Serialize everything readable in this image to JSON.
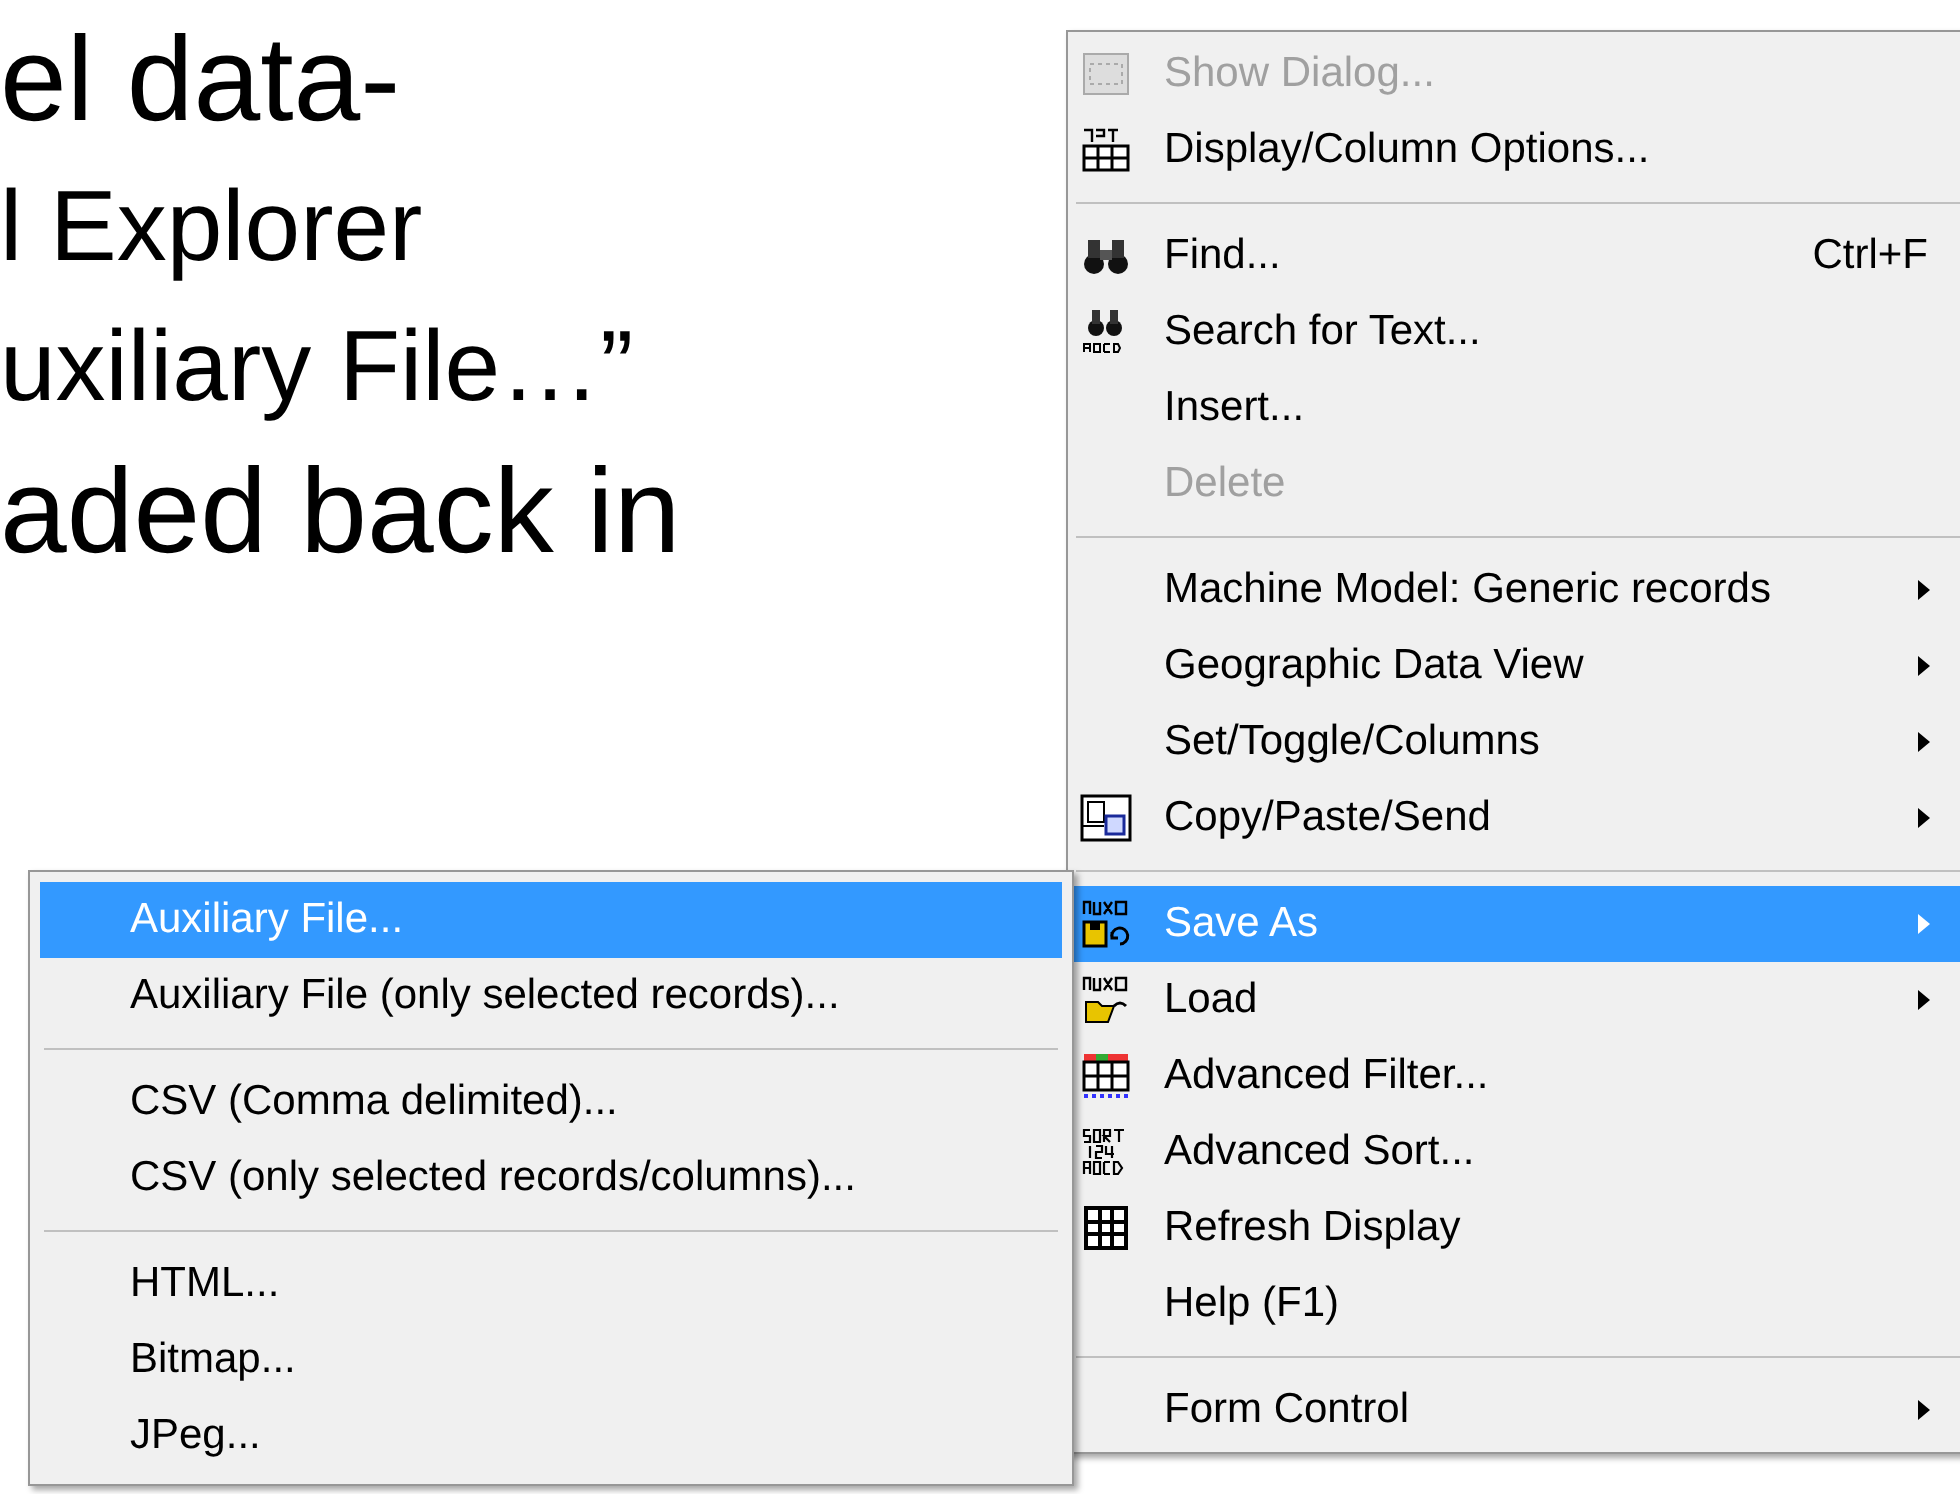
{
  "slide_text": [
    "el data-",
    "l Explorer",
    "uxiliary File…”",
    "aded back in"
  ],
  "context_menu": {
    "items": [
      {
        "kind": "item",
        "label": "Show Dialog...",
        "disabled": true,
        "selected": false,
        "submenu": false
      },
      {
        "kind": "item",
        "label": "Display/Column Options...",
        "disabled": false,
        "selected": false,
        "submenu": false
      },
      {
        "kind": "separator"
      },
      {
        "kind": "item",
        "label": "Find...",
        "shortcut": "Ctrl+F",
        "disabled": false,
        "selected": false,
        "submenu": false
      },
      {
        "kind": "item",
        "label": "Search for Text...",
        "disabled": false,
        "selected": false,
        "submenu": false
      },
      {
        "kind": "item",
        "label": "Insert...",
        "disabled": false,
        "selected": false,
        "submenu": false
      },
      {
        "kind": "item",
        "label": "Delete",
        "disabled": true,
        "selected": false,
        "submenu": false
      },
      {
        "kind": "separator"
      },
      {
        "kind": "item",
        "label": "Machine Model: Generic records",
        "disabled": false,
        "selected": false,
        "submenu": true
      },
      {
        "kind": "item",
        "label": "Geographic Data View",
        "disabled": false,
        "selected": false,
        "submenu": true
      },
      {
        "kind": "item",
        "label": "Set/Toggle/Columns",
        "disabled": false,
        "selected": false,
        "submenu": true
      },
      {
        "kind": "item",
        "label": "Copy/Paste/Send",
        "disabled": false,
        "selected": false,
        "submenu": true
      },
      {
        "kind": "separator"
      },
      {
        "kind": "item",
        "label": "Save As",
        "disabled": false,
        "selected": true,
        "submenu": true
      },
      {
        "kind": "item",
        "label": "Load",
        "disabled": false,
        "selected": false,
        "submenu": true
      },
      {
        "kind": "item",
        "label": "Advanced Filter...",
        "disabled": false,
        "selected": false,
        "submenu": false
      },
      {
        "kind": "item",
        "label": "Advanced Sort...",
        "disabled": false,
        "selected": false,
        "submenu": false
      },
      {
        "kind": "item",
        "label": "Refresh Display",
        "disabled": false,
        "selected": false,
        "submenu": false
      },
      {
        "kind": "item",
        "label": "Help (F1)",
        "disabled": false,
        "selected": false,
        "submenu": false
      },
      {
        "kind": "separator"
      },
      {
        "kind": "item",
        "label": "Form Control",
        "disabled": false,
        "selected": false,
        "submenu": true
      }
    ]
  },
  "save_as_submenu": {
    "items": [
      {
        "kind": "item",
        "label": "Auxiliary File...",
        "selected": true
      },
      {
        "kind": "item",
        "label": "Auxiliary File (only selected records)...",
        "selected": false
      },
      {
        "kind": "separator"
      },
      {
        "kind": "item",
        "label": "CSV (Comma delimited)...",
        "selected": false
      },
      {
        "kind": "item",
        "label": "CSV (only selected records/columns)...",
        "selected": false
      },
      {
        "kind": "separator"
      },
      {
        "kind": "item",
        "label": "HTML...",
        "selected": false
      },
      {
        "kind": "item",
        "label": "Bitmap...",
        "selected": false
      },
      {
        "kind": "item",
        "label": "JPeg...",
        "selected": false
      }
    ]
  }
}
